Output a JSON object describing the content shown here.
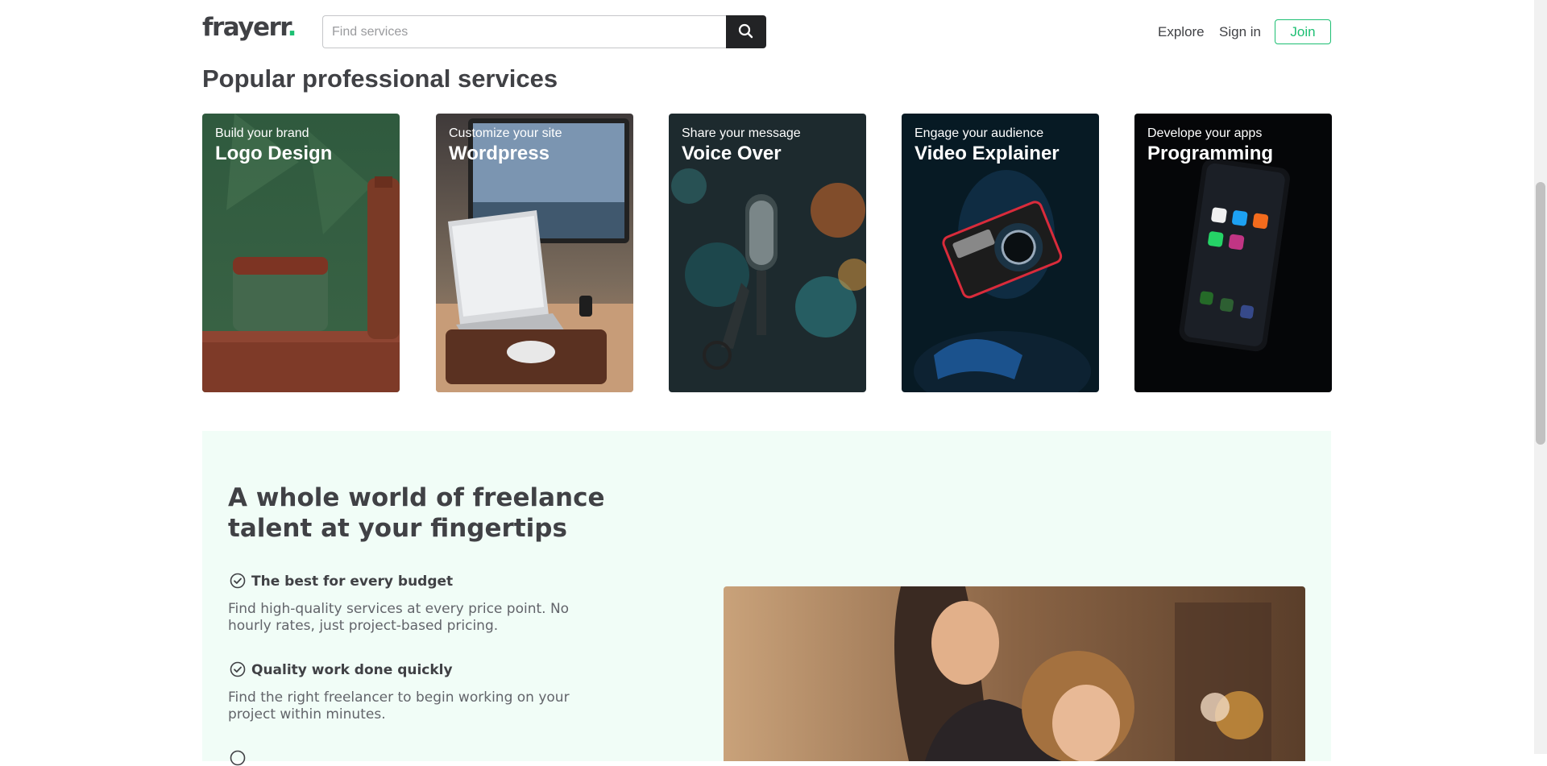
{
  "header": {
    "logo_text": "frayerr",
    "logo_dot": ".",
    "search_placeholder": "Find services",
    "nav": {
      "explore": "Explore",
      "sign_in": "Sign in",
      "join": "Join"
    }
  },
  "popular": {
    "title": "Popular professional services",
    "cards": [
      {
        "subtitle": "Build your brand",
        "name": "Logo Design"
      },
      {
        "subtitle": "Customize your site",
        "name": "Wordpress"
      },
      {
        "subtitle": "Share your message",
        "name": "Voice Over"
      },
      {
        "subtitle": "Engage your audience",
        "name": "Video Explainer"
      },
      {
        "subtitle": "Develope your apps",
        "name": "Programming"
      }
    ]
  },
  "selling": {
    "title": "A whole world of freelance talent at your fingertips",
    "features": [
      {
        "title": "The best for every budget",
        "description": "Find high-quality services at every price point. No hourly rates, just project-based pricing."
      },
      {
        "title": "Quality work done quickly",
        "description": "Find the right freelancer to begin working on your project within minutes."
      }
    ]
  },
  "colors": {
    "brand_green": "#1dbf73",
    "section_bg": "#f1fdf7",
    "text_dark": "#404145",
    "text_muted": "#62646a"
  }
}
